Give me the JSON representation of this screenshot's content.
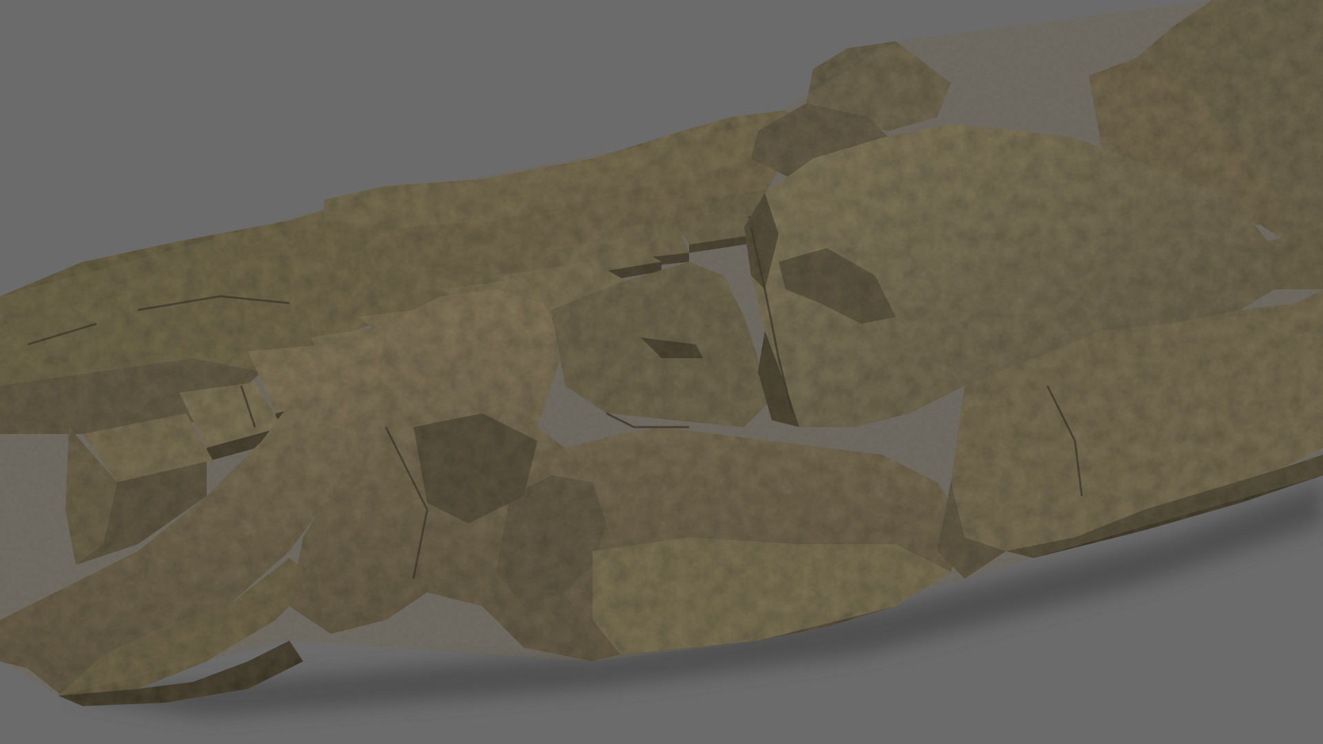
{
  "scene": {
    "subject": "rock-formation-with-carved-steps",
    "background_color": "#6b6b6b",
    "palette": {
      "rock_light": "#8a7d61",
      "rock_mid": "#6f644b",
      "rock_dark": "#4e4635",
      "rock_shadow": "#2f2a21",
      "moss": "#6e6c45",
      "ground_shadow": "#505050"
    }
  }
}
